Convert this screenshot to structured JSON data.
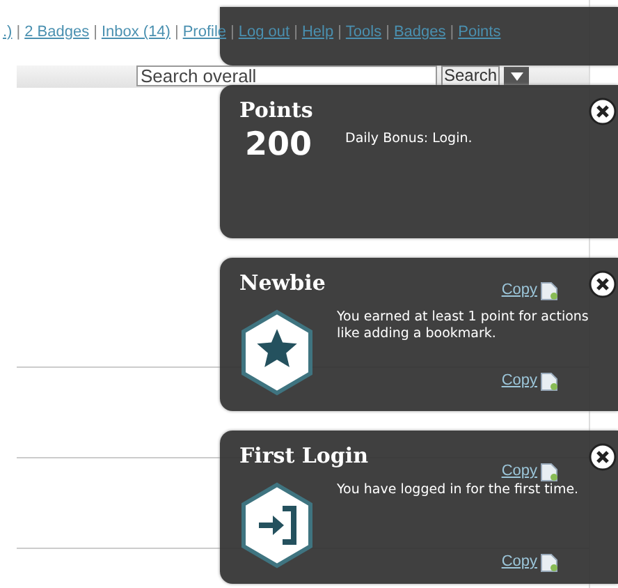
{
  "top_links": [
    {
      "label": ".)",
      "kind": "link"
    },
    {
      "label": "|",
      "kind": "sep"
    },
    {
      "label": "2 Badges",
      "kind": "link"
    },
    {
      "label": "|",
      "kind": "sep"
    },
    {
      "label": "Inbox (14)",
      "kind": "link"
    },
    {
      "label": "|",
      "kind": "sep"
    },
    {
      "label": "Profile",
      "kind": "link"
    },
    {
      "label": "|",
      "kind": "sep"
    },
    {
      "label": "Log out",
      "kind": "link"
    },
    {
      "label": "|",
      "kind": "sep"
    },
    {
      "label": "Help",
      "kind": "link"
    },
    {
      "label": "|",
      "kind": "sep"
    },
    {
      "label": "Tools",
      "kind": "link"
    },
    {
      "label": "|",
      "kind": "sep"
    },
    {
      "label": "Badges",
      "kind": "link"
    },
    {
      "label": "|",
      "kind": "sep"
    },
    {
      "label": "Points",
      "kind": "link"
    }
  ],
  "search": {
    "value": "Search overall",
    "button": "Search"
  },
  "rows": [
    {
      "copy": "Copy"
    },
    {
      "copy": "Copy"
    },
    {
      "copy": "Copy"
    },
    {
      "copy": "Copy"
    }
  ],
  "notifications": [
    {
      "kind": "blank"
    },
    {
      "kind": "points",
      "title": "Points",
      "amount": "200",
      "message": "Daily Bonus: Login."
    },
    {
      "kind": "star",
      "title": "Newbie",
      "message": "You earned at least 1 point for actions like adding a bookmark."
    },
    {
      "kind": "login",
      "title": "First Login",
      "message": "You have logged in for the first time."
    }
  ]
}
